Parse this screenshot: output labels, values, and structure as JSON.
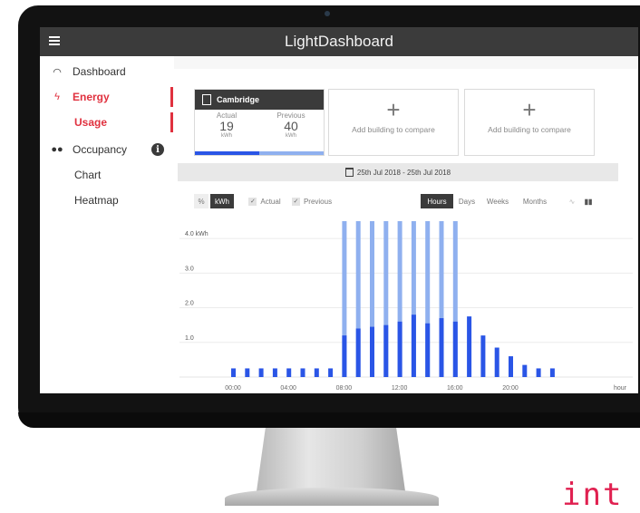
{
  "app": {
    "title": "LightDashboard"
  },
  "sidebar": {
    "items": [
      {
        "label": "Dashboard",
        "icon": "speedometer-icon"
      },
      {
        "label": "Energy",
        "icon": "lightning-icon"
      },
      {
        "label": "Usage"
      },
      {
        "label": "Occupancy",
        "icon": "people-icon"
      },
      {
        "label": "Chart"
      },
      {
        "label": "Heatmap"
      }
    ],
    "info_badge": "i"
  },
  "buildings": {
    "primary": {
      "name": "Cambridge",
      "actual_label": "Actual",
      "actual_value": "19",
      "actual_unit": "kWh",
      "previous_label": "Previous",
      "previous_value": "40",
      "previous_unit": "kWh"
    },
    "add_label": "Add building to compare",
    "add_glyph": "+"
  },
  "date_range": "25th Jul 2018 - 25th Jul 2018",
  "controls": {
    "percent": "%",
    "kwh": "kWh",
    "actual": "Actual",
    "previous": "Previous",
    "hours": "Hours",
    "days": "Days",
    "weeks": "Weeks",
    "months": "Months"
  },
  "colors": {
    "accent": "#e0313f",
    "actual": "#2a55e6",
    "previous": "#8fb0ef",
    "dark": "#3b3b3b"
  },
  "chart_data": {
    "type": "bar",
    "ylabel": "kWh",
    "ylim": [
      0,
      4.5
    ],
    "yticks": [
      {
        "v": 4.0,
        "label": "4.0 kWh"
      },
      {
        "v": 3.0,
        "label": "3.0"
      },
      {
        "v": 2.0,
        "label": "2.0"
      },
      {
        "v": 1.0,
        "label": "1.0"
      }
    ],
    "xticks": [
      {
        "h": 0,
        "label": "00:00"
      },
      {
        "h": 4,
        "label": "04:00"
      },
      {
        "h": 8,
        "label": "08:00"
      },
      {
        "h": 12,
        "label": "12:00"
      },
      {
        "h": 16,
        "label": "16:00"
      },
      {
        "h": 20,
        "label": "20:00"
      }
    ],
    "xlabel": "hour",
    "series": [
      {
        "name": "Previous",
        "values": [
          null,
          null,
          null,
          null,
          null,
          null,
          null,
          null,
          4.5,
          4.5,
          4.5,
          4.5,
          4.5,
          4.5,
          4.5,
          4.5,
          4.5,
          null,
          null,
          null,
          null,
          null,
          null,
          null
        ]
      },
      {
        "name": "Actual",
        "values": [
          0.25,
          0.25,
          0.25,
          0.25,
          0.25,
          0.25,
          0.25,
          0.25,
          1.2,
          1.4,
          1.45,
          1.5,
          1.6,
          1.8,
          1.55,
          1.7,
          1.6,
          1.75,
          1.2,
          0.85,
          0.6,
          0.35,
          0.25,
          0.25
        ]
      }
    ]
  }
}
